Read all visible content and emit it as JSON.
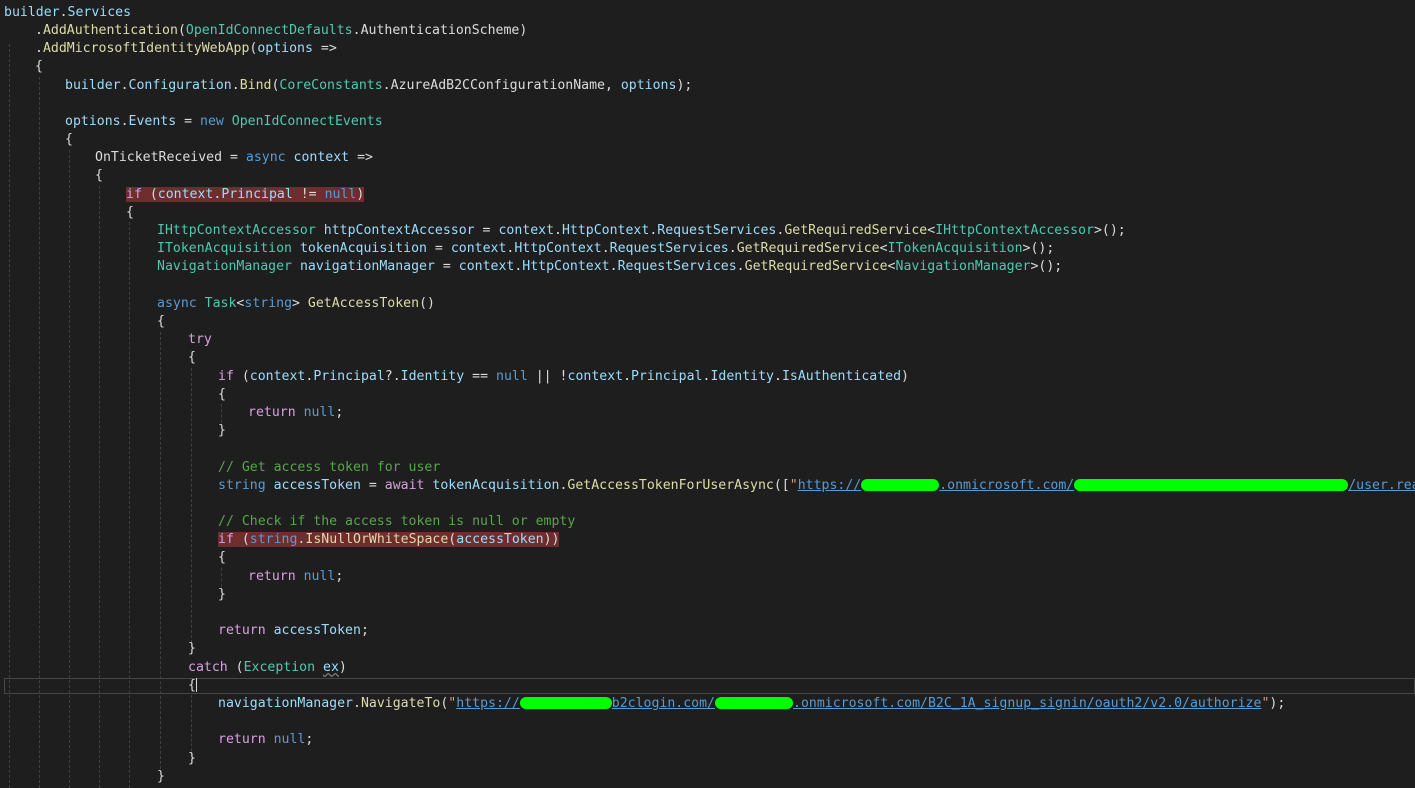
{
  "code": {
    "builder": "builder",
    "services": "Services",
    "add_authentication": "AddAuthentication",
    "oidc_defaults": "OpenIdConnectDefaults",
    "auth_scheme": "AuthenticationScheme",
    "add_ms_identity": "AddMicrosoftIdentityWebApp",
    "options": "options",
    "arrow": "=>",
    "configuration": "Configuration",
    "bind": "Bind",
    "core_constants": "CoreConstants",
    "config_name": "AzureAdB2CConfigurationName",
    "events": "Events",
    "new_kw": "new",
    "oidc_events": "OpenIdConnectEvents",
    "on_ticket_received": "OnTicketReceived",
    "async_kw": "async",
    "context": "context",
    "if_kw": "if",
    "principal": "Principal",
    "null_kw": "null",
    "neq": "!=",
    "ihttp_accessor": "IHttpContextAccessor",
    "http_accessor_var": "httpContextAccessor",
    "http_context": "HttpContext",
    "request_services": "RequestServices",
    "get_required_service": "GetRequiredService",
    "itoken_acq": "ITokenAcquisition",
    "token_acq_var": "tokenAcquisition",
    "nav_manager": "NavigationManager",
    "nav_manager_var": "navigationManager",
    "task": "Task",
    "string_kw": "string",
    "get_access_token": "GetAccessToken",
    "try_kw": "try",
    "identity": "Identity",
    "eqeq": "==",
    "or_op": "||",
    "is_authenticated": "IsAuthenticated",
    "return_kw": "return",
    "comment_get_token": "// Get access token for user",
    "access_token_var": "accessToken",
    "await_kw": "await",
    "get_token_for_user": "GetAccessTokenForUserAsync",
    "url1_prefix": "https://",
    "url1_mid": ".onmicrosoft.com/",
    "url1_suffix": "/user.read",
    "comment_check": "// Check if the access token is null or empty",
    "is_null_or_ws": "IsNullOrWhiteSpace",
    "catch_kw": "catch",
    "exception": "Exception",
    "ex_var": "ex",
    "navigate_to": "NavigateTo",
    "url2_prefix": "https://",
    "url2_mid1": "b2clogin.com/",
    "url2_mid2": ".onmicrosoft.com/B2C_1A_signup_signin/oauth2/v2.0/authorize"
  },
  "colors": {
    "background": "#1e1e1e",
    "keyword": "#569cd6",
    "control": "#d8a0df",
    "type": "#4ec9b0",
    "method": "#dcdcaa",
    "variable": "#9cdcfe",
    "string": "#d69d85",
    "comment": "#57a64a",
    "breakpoint_highlight": "#6f2d2d",
    "redaction": "#00ff00"
  }
}
